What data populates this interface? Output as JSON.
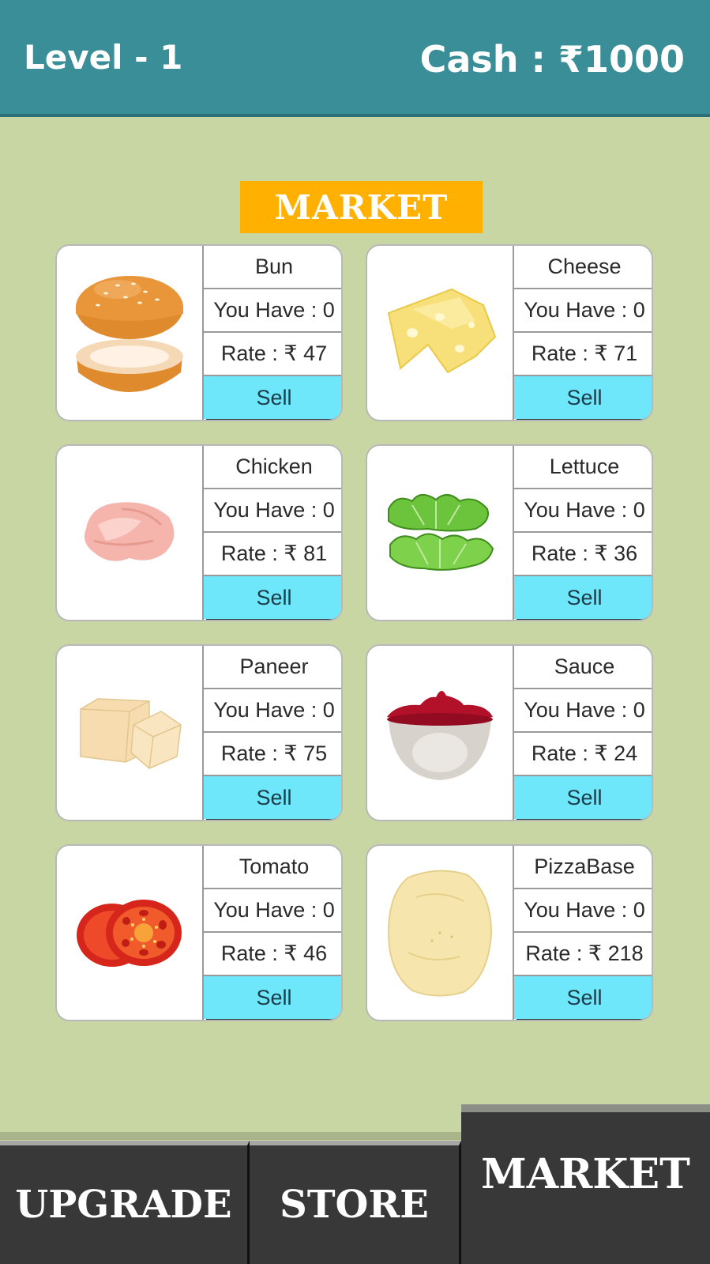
{
  "header": {
    "level": "Level - 1",
    "cash": "Cash : ₹1000"
  },
  "market": {
    "title": "MARKET",
    "items": [
      {
        "name": "Bun",
        "have": "You Have : 0",
        "rate": "Rate : ₹ 47",
        "sell": "Sell",
        "icon": "bun-icon"
      },
      {
        "name": "Cheese",
        "have": "You Have : 0",
        "rate": "Rate : ₹ 71",
        "sell": "Sell",
        "icon": "cheese-icon"
      },
      {
        "name": "Chicken",
        "have": "You Have : 0",
        "rate": "Rate : ₹ 81",
        "sell": "Sell",
        "icon": "chicken-icon"
      },
      {
        "name": "Lettuce",
        "have": "You Have : 0",
        "rate": "Rate : ₹ 36",
        "sell": "Sell",
        "icon": "lettuce-icon"
      },
      {
        "name": "Paneer",
        "have": "You Have : 0",
        "rate": "Rate : ₹ 75",
        "sell": "Sell",
        "icon": "paneer-icon"
      },
      {
        "name": "Sauce",
        "have": "You Have : 0",
        "rate": "Rate : ₹ 24",
        "sell": "Sell",
        "icon": "sauce-icon"
      },
      {
        "name": "Tomato",
        "have": "You Have : 0",
        "rate": "Rate : ₹ 46",
        "sell": "Sell",
        "icon": "tomato-icon"
      },
      {
        "name": "PizzaBase",
        "have": "You Have : 0",
        "rate": "Rate : ₹ 218",
        "sell": "Sell",
        "icon": "pizzabase-icon"
      }
    ]
  },
  "nav": {
    "upgrade": "UPGRADE",
    "store": "STORE",
    "market": "MARKET",
    "active": "MARKET"
  },
  "colors": {
    "header": "#3a8e97",
    "background": "#c8d6a4",
    "title_badge": "#ffb000",
    "sell_button": "#6ee7fa",
    "nav": "#383838"
  }
}
